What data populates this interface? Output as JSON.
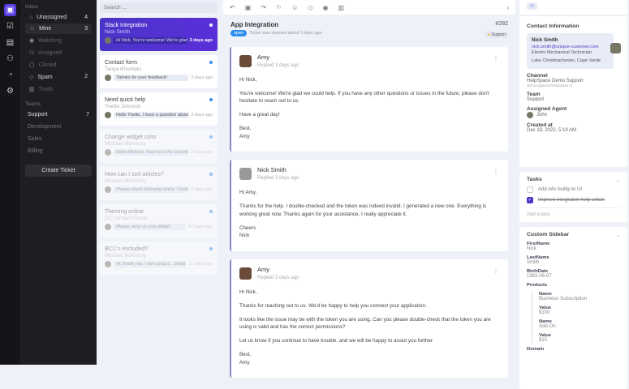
{
  "rail": {
    "icons": [
      "inbox-icon",
      "tasks-icon",
      "document-icon",
      "users-icon",
      "reports-icon",
      "settings-icon"
    ]
  },
  "nav": {
    "inbox_header": "Inbox",
    "items": [
      {
        "label": "Unassigned",
        "count": "4"
      },
      {
        "label": "Mine",
        "count": "3"
      },
      {
        "label": "Watching",
        "count": ""
      },
      {
        "label": "Assigned",
        "count": ""
      },
      {
        "label": "Closed",
        "count": ""
      },
      {
        "label": "Spam",
        "count": "2"
      },
      {
        "label": "Trash",
        "count": ""
      }
    ],
    "teams_header": "Teams",
    "teams": [
      {
        "label": "Support",
        "count": "7"
      },
      {
        "label": "Development",
        "count": ""
      },
      {
        "label": "Sales",
        "count": ""
      },
      {
        "label": "Billing",
        "count": ""
      }
    ],
    "create_label": "Create Ticket"
  },
  "list": {
    "search_placeholder": "Search ...",
    "tickets": [
      {
        "title": "Slack Integration",
        "name": "Nick Smith",
        "preview": "Hi Nick, You're welcome! We're glad ...",
        "time": "3 days ago"
      },
      {
        "title": "Contact form",
        "name": "Tanya Khumalo",
        "preview": "Tahnks for your feedback!",
        "time": "3 days ago"
      },
      {
        "title": "Need quick help",
        "name": "Yvette Johnson",
        "preview": "Hello Yvette, I have a question about ...",
        "time": "3 days ago"
      },
      {
        "title": "Change widget color",
        "name": "Michael McKenzy",
        "preview": "Hello Michael, Thank you for reachin...",
        "time": "3 days ago"
      },
      {
        "title": "How can I sort articles?",
        "name": "Michael McKenzy",
        "preview": "Please check following article: Create...",
        "time": "3 days ago"
      },
      {
        "title": "Theming online",
        "name": "DC contact Fdune",
        "preview": "Please send us your details",
        "time": "10 days ago"
      },
      {
        "title": "BCC's excluded?",
        "name": "Michael McKenzy",
        "preview": "Hi, thank you, I will contact... Setup...",
        "time": "11 days ago"
      }
    ]
  },
  "ticket": {
    "title": "App Integration",
    "status": "open",
    "opened": "Ticket was opened about 3 days ago",
    "number": "#282",
    "team_tag": "Support",
    "messages": [
      {
        "author": "Amy",
        "replied": "Replied 3 days ago",
        "paragraphs": [
          "Hi Nick,",
          "You're welcome! We're glad we could help. If you have any other questions or issues in the future, please don't hesitate to reach out to us.",
          "Have a great day!",
          "Best,\nAmy"
        ]
      },
      {
        "author": "Nick Smith",
        "replied": "Replied 3 days ago",
        "paragraphs": [
          "Hi Amy,",
          "Thanks for the help. I double-checked and the token was indeed invalid. I generated a new one. Everything is working great now. Thanks again for your assistance, I really appreciate it.",
          "Cheers\nNick"
        ]
      },
      {
        "author": "Amy",
        "replied": "Replied 3 days ago",
        "paragraphs": [
          "Hi Nick,",
          "Thanks for reaching out to us. We'd be happy to help you connect your application.",
          "It looks like the issue may be with the token you are using. Can you please double-check that the token you are using is valid and has the correct permissions?",
          "Let us know if you continue to have trouble, and we will be happy to assist you further.",
          "Best,\nAmy"
        ]
      }
    ]
  },
  "contact": {
    "header": "Contact Information",
    "name": "Nick Smith",
    "email": "nick.smith@unique-customer.com",
    "job": "Electro-Mechanical Technician",
    "location": "Lake Christinachester, Cape Verde",
    "channel_label": "Channel",
    "channel": "HelpSpace Demo Support",
    "channel_email": "demosupport@helpspace.io",
    "team_label": "Team",
    "team": "Support",
    "agent_label": "Assigned Agent",
    "agent": "John",
    "created_label": "Created at",
    "created": "Dec 19, 2022, 5:19 AM"
  },
  "tasks": {
    "header": "Tasks",
    "items": [
      {
        "label": "Add info tooltip to UI",
        "done": false
      },
      {
        "label": "Improve integration help article",
        "done": true
      }
    ],
    "add_label": "Add a task"
  },
  "custom": {
    "header": "Custom Sidebar",
    "firstname_label": "FirstName",
    "firstname": "Nick",
    "lastname_label": "LastName",
    "lastname": "Smith",
    "birth_label": "BirthDate",
    "birth": "1983-06-07",
    "products_label": "Products",
    "products": [
      {
        "name_label": "Name",
        "name": "Business Subscription",
        "value_label": "Value",
        "value": "$100"
      },
      {
        "name_label": "Name",
        "name": "Add-On",
        "value_label": "Value",
        "value": "$15"
      }
    ],
    "domain_label": "Domain"
  }
}
